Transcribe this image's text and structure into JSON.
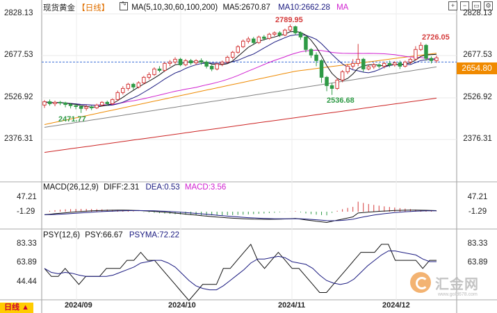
{
  "header": {
    "title": "现货黄金",
    "period": "【日线】",
    "ma_label": "MA(5,10,30,60,100,200)",
    "ma5": "MA5:2670.87",
    "ma10": "MA10:2662.28",
    "ma_more": "MA"
  },
  "toolbar": {
    "buttons": [
      "zoom-in-icon",
      "zoom-out-icon",
      "fit-icon",
      "settings-icon"
    ]
  },
  "price_axis": {
    "labels": [
      "2828.13",
      "2677.53",
      "2526.92",
      "2376.31"
    ],
    "current": "2654.80"
  },
  "annotations": {
    "high": "2789.95",
    "high2": "2726.05",
    "low1": "2471.77",
    "low2": "2536.68"
  },
  "macd": {
    "title": "MACD(26,12,9)",
    "diff": "DIFF:2.31",
    "dea": "DEA:0.53",
    "macd": "MACD:3.56",
    "axis": [
      "47.21",
      "-1.29"
    ],
    "left_axis": [
      "47.21",
      "-1.29"
    ]
  },
  "psy": {
    "title": "PSY(12,6)",
    "psy": "PSY:66.67",
    "psyma": "PSYMA:72.22",
    "axis": [
      "83.33",
      "63.89"
    ],
    "left_axis": [
      "83.33",
      "63.89",
      "44.44"
    ]
  },
  "x_axis": [
    "2024/09",
    "2024/10",
    "2024/11",
    "2024/12"
  ],
  "period_tag": "日线 ▲",
  "watermark": {
    "text": "汇金网",
    "sub": "www.gold678.com"
  },
  "colors": {
    "up": "#d43a3a",
    "down": "#2e9a45",
    "ma5": "#111111",
    "ma10": "#1a1a80",
    "ma30": "#d020d0",
    "ma60": "#ee8a00",
    "ma100": "#808080",
    "ma200": "#cc2222",
    "ref_line": "#3a6fd8"
  },
  "chart_data": {
    "type": "candlestick",
    "candles": [
      [
        2500,
        2512,
        2490,
        2518
      ],
      [
        2512,
        2505,
        2498,
        2520
      ],
      [
        2505,
        2510,
        2496,
        2516
      ],
      [
        2510,
        2508,
        2500,
        2515
      ],
      [
        2508,
        2502,
        2492,
        2512
      ],
      [
        2502,
        2498,
        2488,
        2508
      ],
      [
        2498,
        2495,
        2485,
        2503
      ],
      [
        2495,
        2488,
        2471.77,
        2498
      ],
      [
        2488,
        2494,
        2480,
        2500
      ],
      [
        2494,
        2490,
        2482,
        2498
      ],
      [
        2490,
        2500,
        2486,
        2505
      ],
      [
        2500,
        2510,
        2496,
        2514
      ],
      [
        2510,
        2505,
        2498,
        2516
      ],
      [
        2505,
        2520,
        2500,
        2524
      ],
      [
        2520,
        2545,
        2515,
        2552
      ],
      [
        2545,
        2560,
        2538,
        2568
      ],
      [
        2560,
        2575,
        2552,
        2580
      ],
      [
        2575,
        2565,
        2555,
        2580
      ],
      [
        2565,
        2580,
        2560,
        2586
      ],
      [
        2580,
        2600,
        2575,
        2605
      ],
      [
        2600,
        2610,
        2592,
        2618
      ],
      [
        2610,
        2630,
        2605,
        2636
      ],
      [
        2630,
        2625,
        2618,
        2640
      ],
      [
        2625,
        2650,
        2620,
        2655
      ],
      [
        2650,
        2655,
        2640,
        2662
      ],
      [
        2655,
        2665,
        2648,
        2672
      ],
      [
        2665,
        2645,
        2640,
        2670
      ],
      [
        2645,
        2660,
        2640,
        2666
      ],
      [
        2660,
        2652,
        2645,
        2666
      ],
      [
        2652,
        2660,
        2645,
        2665
      ],
      [
        2660,
        2655,
        2645,
        2668
      ],
      [
        2655,
        2640,
        2632,
        2660
      ],
      [
        2640,
        2630,
        2622,
        2645
      ],
      [
        2630,
        2648,
        2625,
        2652
      ],
      [
        2648,
        2655,
        2640,
        2660
      ],
      [
        2655,
        2672,
        2650,
        2678
      ],
      [
        2672,
        2690,
        2665,
        2695
      ],
      [
        2690,
        2710,
        2685,
        2716
      ],
      [
        2710,
        2730,
        2705,
        2736
      ],
      [
        2730,
        2738,
        2722,
        2746
      ],
      [
        2738,
        2725,
        2718,
        2745
      ],
      [
        2725,
        2745,
        2720,
        2750
      ],
      [
        2745,
        2740,
        2732,
        2752
      ],
      [
        2740,
        2755,
        2735,
        2760
      ],
      [
        2755,
        2760,
        2748,
        2765
      ],
      [
        2760,
        2752,
        2745,
        2766
      ],
      [
        2752,
        2770,
        2748,
        2775
      ],
      [
        2770,
        2782,
        2765,
        2789.95
      ],
      [
        2782,
        2760,
        2752,
        2786
      ],
      [
        2760,
        2745,
        2735,
        2765
      ],
      [
        2745,
        2700,
        2690,
        2748
      ],
      [
        2700,
        2680,
        2670,
        2705
      ],
      [
        2680,
        2660,
        2640,
        2690
      ],
      [
        2660,
        2600,
        2580,
        2665
      ],
      [
        2600,
        2570,
        2550,
        2605
      ],
      [
        2570,
        2560,
        2536.68,
        2580
      ],
      [
        2560,
        2590,
        2555,
        2598
      ],
      [
        2590,
        2620,
        2582,
        2626
      ],
      [
        2620,
        2640,
        2612,
        2648
      ],
      [
        2640,
        2650,
        2630,
        2665
      ],
      [
        2650,
        2665,
        2640,
        2720
      ],
      [
        2665,
        2630,
        2620,
        2670
      ],
      [
        2630,
        2638,
        2625,
        2645
      ],
      [
        2638,
        2645,
        2630,
        2652
      ],
      [
        2645,
        2640,
        2632,
        2650
      ],
      [
        2640,
        2650,
        2632,
        2656
      ],
      [
        2650,
        2645,
        2636,
        2660
      ],
      [
        2645,
        2652,
        2638,
        2658
      ],
      [
        2652,
        2640,
        2630,
        2660
      ],
      [
        2640,
        2655,
        2635,
        2660
      ],
      [
        2655,
        2665,
        2648,
        2670
      ],
      [
        2665,
        2700,
        2660,
        2712
      ],
      [
        2700,
        2715,
        2695,
        2726.05
      ],
      [
        2715,
        2668,
        2660,
        2720
      ],
      [
        2668,
        2660,
        2650,
        2675
      ],
      [
        2660,
        2670,
        2652,
        2678
      ]
    ],
    "psy_values": [
      58.3,
      50,
      50,
      58.3,
      50,
      41.7,
      50,
      50,
      50,
      58.3,
      58.3,
      58.3,
      66.7,
      66.7,
      75,
      66.7,
      66.7,
      58.3,
      50,
      41.7,
      33.3,
      25,
      33.3,
      41.7,
      41.7,
      41.7,
      58.3,
      58.3,
      66.7,
      75,
      83.3,
      66.7,
      58.3,
      66.7,
      75,
      66.7,
      58.3,
      58.3,
      50,
      41.7,
      33.3,
      33.3,
      41.7,
      50,
      58.3,
      66.7,
      75,
      75,
      75,
      83.3,
      83.3,
      66.7,
      66.7,
      66.7,
      66.7,
      58.3,
      66.7,
      66.7
    ],
    "xlabel": "",
    "ylabel": ""
  }
}
